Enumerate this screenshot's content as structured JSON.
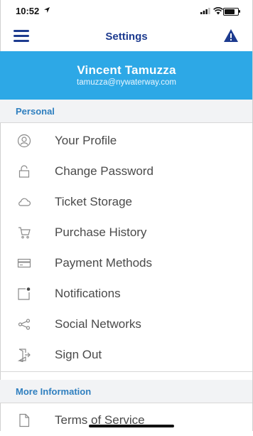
{
  "status_bar": {
    "time": "10:52"
  },
  "nav": {
    "title": "Settings",
    "menu_icon": "hamburger-menu-icon",
    "alert_icon": "warning-triangle-icon"
  },
  "profile": {
    "name": "Vincent Tamuzza",
    "email": "tamuzza@nywaterway.com"
  },
  "personal": {
    "heading": "Personal",
    "items": [
      {
        "label": "Your Profile",
        "icon": "user-circle-icon"
      },
      {
        "label": "Change Password",
        "icon": "lock-icon"
      },
      {
        "label": "Ticket Storage",
        "icon": "cloud-icon"
      },
      {
        "label": "Purchase History",
        "icon": "cart-icon"
      },
      {
        "label": "Payment Methods",
        "icon": "credit-card-icon"
      },
      {
        "label": "Notifications",
        "icon": "notification-badge-icon"
      },
      {
        "label": "Social Networks",
        "icon": "share-icon"
      },
      {
        "label": "Sign Out",
        "icon": "sign-out-icon"
      }
    ]
  },
  "more": {
    "heading": "More Information",
    "items": [
      {
        "label": "Terms of Service",
        "icon": "document-icon"
      }
    ]
  },
  "colors": {
    "accent": "#1d3b8f",
    "header_bg": "#2da8e6",
    "section_text": "#2f7fbf",
    "item_text": "#4a4a4a"
  }
}
